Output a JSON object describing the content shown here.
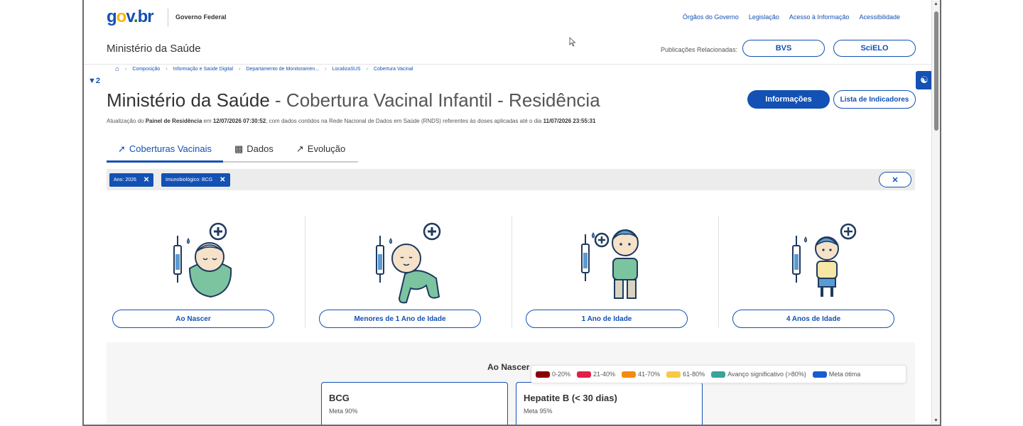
{
  "header": {
    "logo": "gov.br",
    "gov_label": "Governo Federal",
    "links": [
      "Órgãos do Governo",
      "Legislação",
      "Acesso à Informação",
      "Acessibilidade"
    ],
    "ministry": "Ministério da Saúde",
    "publications_label": "Publicações Relacionadas:",
    "pub_buttons": [
      "BVS",
      "SciELO"
    ]
  },
  "breadcrumb": [
    "Composição",
    "Informação e Saúde Digital",
    "Departamento de Monitoramen...",
    "LocalizaSUS",
    "Cobertura Vacinal"
  ],
  "filter_count": "2",
  "title": {
    "main": "Ministério da Saúde",
    "dash": " - ",
    "sub": "Cobertura Vacinal Infantil - Residência"
  },
  "actions": {
    "info": "Informações",
    "lista": "Lista de Indicadores"
  },
  "update": {
    "p1": "Atualização do ",
    "panel": "Painel de Residência",
    "p2": " em ",
    "date1": "12/07/2026 07:30:52",
    "p3": ", com dados contidos na Rede Nacional de Dados em Saúde (RNDS) referentes às doses aplicadas até o dia ",
    "date2": "11/07/2026 23:55:31"
  },
  "tabs": [
    "Coberturas Vacinais",
    "Dados",
    "Evolução"
  ],
  "chips": [
    "Ano: 2026",
    "Imunobiológico: BCG"
  ],
  "age_groups": [
    "Ao Nascer",
    "Menores de 1 Ano de Idade",
    "1 Ano de Idade",
    "4 Anos de Idade"
  ],
  "section_title": "Ao Nascer",
  "legend": [
    {
      "label": "0-20%",
      "color": "#8b0000"
    },
    {
      "label": "21-40%",
      "color": "#e0204a"
    },
    {
      "label": "41-70%",
      "color": "#f28c0f"
    },
    {
      "label": "61-80%",
      "color": "#f7c948"
    },
    {
      "label": "Avanço significativo (>80%)",
      "color": "#3aa39a"
    },
    {
      "label": "Meta ótima",
      "color": "#1a5bd1"
    }
  ],
  "vaccines": [
    {
      "name": "BCG",
      "meta": "Meta 90%"
    },
    {
      "name": "Hepatite B (< 30 dias)",
      "meta": "Meta 95%"
    }
  ]
}
